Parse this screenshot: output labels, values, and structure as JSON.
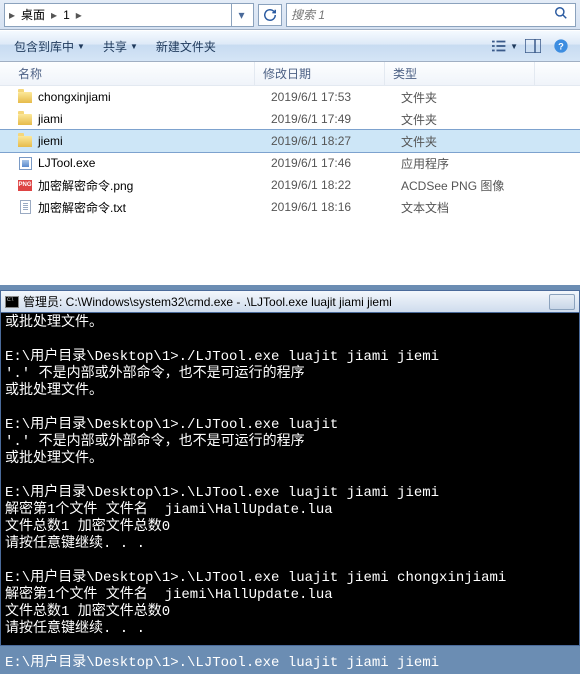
{
  "breadcrumb": {
    "seg1": "桌面",
    "seg2": "1"
  },
  "search": {
    "placeholder": "搜索 1"
  },
  "toolbar": {
    "include": "包含到库中",
    "share": "共享",
    "newfolder": "新建文件夹"
  },
  "columns": {
    "name": "名称",
    "date": "修改日期",
    "type": "类型"
  },
  "files": [
    {
      "icon": "folder",
      "name": "chongxinjiami",
      "date": "2019/6/1 17:53",
      "type": "文件夹"
    },
    {
      "icon": "folder",
      "name": "jiami",
      "date": "2019/6/1 17:49",
      "type": "文件夹"
    },
    {
      "icon": "folder",
      "name": "jiemi",
      "date": "2019/6/1 18:27",
      "type": "文件夹",
      "selected": true
    },
    {
      "icon": "exe",
      "name": "LJTool.exe",
      "date": "2019/6/1 17:46",
      "type": "应用程序"
    },
    {
      "icon": "png",
      "name": "加密解密命令.png",
      "date": "2019/6/1 18:22",
      "type": "ACDSee PNG 图像"
    },
    {
      "icon": "txt",
      "name": "加密解密命令.txt",
      "date": "2019/6/1 18:16",
      "type": "文本文档"
    }
  ],
  "cmd": {
    "title": "管理员: C:\\Windows\\system32\\cmd.exe - .\\LJTool.exe  luajit jiami jiemi",
    "lines": [
      "或批处理文件。",
      "",
      "E:\\用户目录\\Desktop\\1>./LJTool.exe luajit jiami jiemi",
      "'.' 不是内部或外部命令，也不是可运行的程序",
      "或批处理文件。",
      "",
      "E:\\用户目录\\Desktop\\1>./LJTool.exe luajit",
      "'.' 不是内部或外部命令，也不是可运行的程序",
      "或批处理文件。",
      "",
      "E:\\用户目录\\Desktop\\1>.\\LJTool.exe luajit jiami jiemi",
      "解密第1个文件 文件名  jiami\\HallUpdate.lua",
      "文件总数1 加密文件总数0",
      "请按任意键继续. . .",
      "",
      "E:\\用户目录\\Desktop\\1>.\\LJTool.exe luajit jiemi chongxinjiami",
      "解密第1个文件 文件名  jiemi\\HallUpdate.lua",
      "文件总数1 加密文件总数0",
      "请按任意键继续. . .",
      "",
      "E:\\用户目录\\Desktop\\1>.\\LJTool.exe luajit jiami jiemi"
    ]
  }
}
